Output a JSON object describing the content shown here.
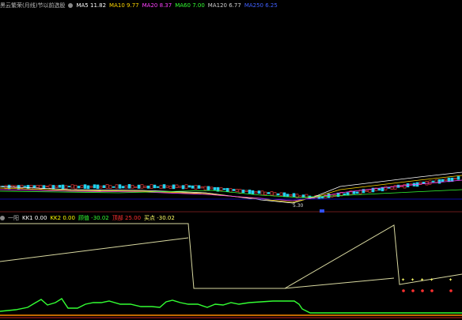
{
  "top_legend": {
    "title": "黑云繁荣(月线)节以前选股",
    "items": [
      {
        "label": "MA5",
        "value": "11.82",
        "color": "#ffffff"
      },
      {
        "label": "MA10",
        "value": "9.77",
        "color": "#ffd700"
      },
      {
        "label": "MA20",
        "value": "8.37",
        "color": "#ff40ff"
      },
      {
        "label": "MA60",
        "value": "7.00",
        "color": "#33ff33"
      },
      {
        "label": "MA120",
        "value": "6.77",
        "color": "#d0d0d0"
      },
      {
        "label": "MA250",
        "value": "6.25",
        "color": "#4060ff"
      }
    ]
  },
  "price_marker": "5.30",
  "bottom_legend": {
    "title": "一阳",
    "items": [
      {
        "label": "KK1",
        "value": "0.00",
        "color": "#ffffff"
      },
      {
        "label": "KK2",
        "value": "0.00",
        "color": "#ffff00"
      },
      {
        "label": "顾值",
        "value": "-30.02",
        "color": "#33ff33"
      },
      {
        "label": "顶部",
        "value": "25.00",
        "color": "#ff3030"
      },
      {
        "label": "买点",
        "value": "-30.02",
        "color": "#ffff66"
      }
    ]
  },
  "colors": {
    "up": "#ff4040",
    "down": "#22d3ee",
    "axis": "#6a1a1a",
    "band": "#0a0aa0"
  }
}
